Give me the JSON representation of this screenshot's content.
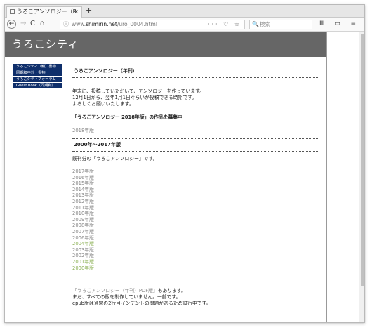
{
  "browser": {
    "tab_title": "うろこアンソロジー（R",
    "tab_close": "×",
    "new_tab": "+",
    "url_prefix": "www.",
    "url_host": "shimirin.net",
    "url_path": "/uro_0004.html",
    "url_actions": "··· ♡ ☆",
    "search_placeholder": "検索",
    "search_icon": "🔍",
    "toolbar_glyphs": "Ⅲ ▭ ≡"
  },
  "site": {
    "title": "うろこシティ",
    "nav": [
      "うろこシティ（鱗）書物",
      "同期和中外・書物",
      "うろこシティフォーラム",
      "Guest Book（同期和）"
    ]
  },
  "content": {
    "heading1": "うろこアンソロジー（年刊）",
    "intro": [
      "年末に、投稿していただいて、アンソロジーを作っています。",
      "12月1日から、翌年1月1日ぐらいが投稿できる時期です。",
      "よろしくお願いいたします。"
    ],
    "call_heading": "「うろこアンソロジー 2018年版」の作品を募集中",
    "current_edition": "2018年版",
    "heading2": "2000年〜2017年版",
    "published_note": "既刊分の「うろこアンソロジー」です。",
    "years": [
      {
        "label": "2017年版",
        "status": "muted"
      },
      {
        "label": "2016年版",
        "status": "muted"
      },
      {
        "label": "2015年版",
        "status": "muted"
      },
      {
        "label": "2014年版",
        "status": "muted"
      },
      {
        "label": "2013年版",
        "status": "muted"
      },
      {
        "label": "2012年版",
        "status": "muted"
      },
      {
        "label": "2011年版",
        "status": "muted"
      },
      {
        "label": "2010年版",
        "status": "muted"
      },
      {
        "label": "2009年版",
        "status": "muted"
      },
      {
        "label": "2008年版",
        "status": "muted"
      },
      {
        "label": "2007年版",
        "status": "muted"
      },
      {
        "label": "2006年版",
        "status": "muted"
      },
      {
        "label": "2004年版",
        "status": "green"
      },
      {
        "label": "2003年版",
        "status": "muted"
      },
      {
        "label": "2002年版",
        "status": "muted"
      },
      {
        "label": "2001年版",
        "status": "green"
      },
      {
        "label": "2000年版",
        "status": "green"
      }
    ],
    "pdf_link": "「うろこアンソロジー（年刊）PDF版」",
    "pdf_tail": "もあります。",
    "note2": "まだ、すべての版を制作していません。一部です。",
    "note3": "epub版は通常の2行目インデントの問題があるため試行中です。"
  },
  "colors": {
    "banner": "#666666",
    "nav_bg": "#0f2f6b",
    "green_link": "#8fb35a",
    "muted_link": "#888888"
  }
}
